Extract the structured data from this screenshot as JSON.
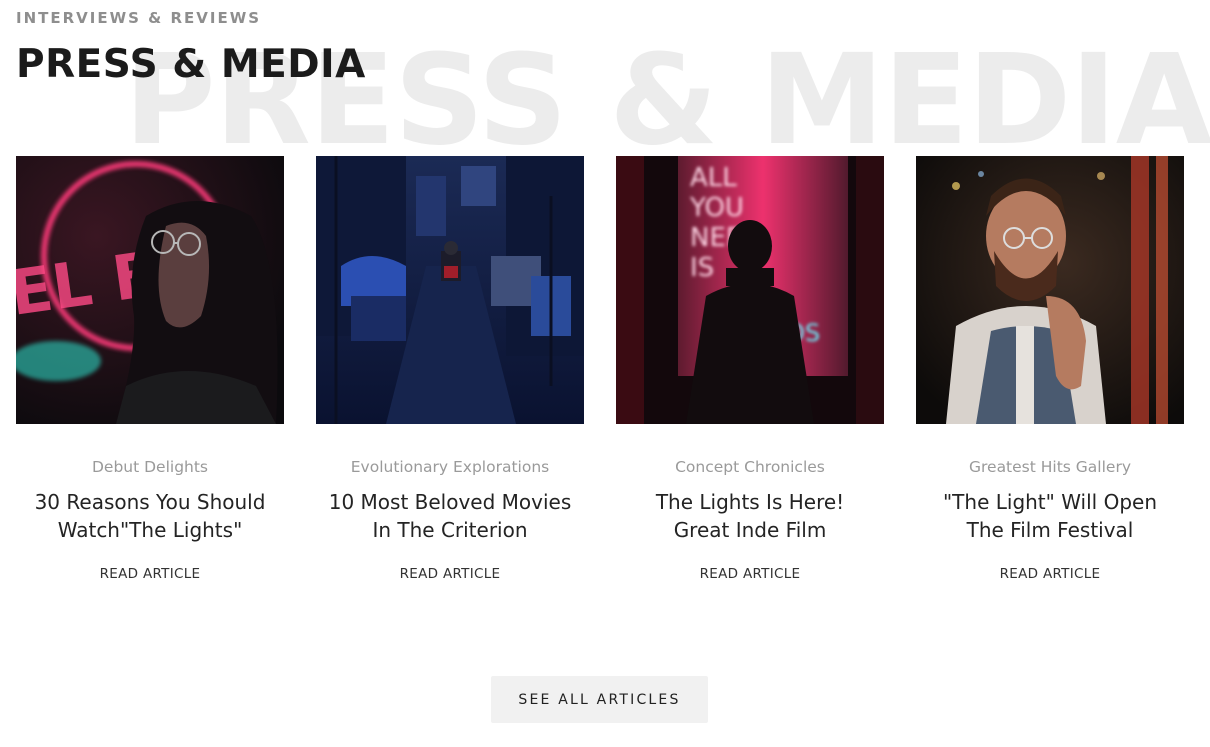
{
  "section": {
    "kicker": "INTERVIEWS & REVIEWS",
    "title": "PRESS & MEDIA",
    "background_title": "PRESS & MEDIA"
  },
  "articles": [
    {
      "category": "Debut Delights",
      "title_line1": "30 Reasons You Should",
      "title_line2": "Watch\"The Lights\"",
      "cta": "READ ARTICLE",
      "image": "woman-with-glasses-neon-sign-photo",
      "neon_sign_text": "EL B"
    },
    {
      "category": "Evolutionary Explorations",
      "title_line1": "10 Most Beloved Movies",
      "title_line2": "In The Criterion",
      "cta": "READ ARTICLE",
      "image": "night-alley-blue-photo"
    },
    {
      "category": "Concept Chronicles",
      "title_line1": "The Lights Is Here!",
      "title_line2": "Great Inde Film",
      "cta": "READ ARTICLE",
      "image": "man-before-neon-sign-photo",
      "neon_sign_text": "ALL YOU NEED IS LOVE"
    },
    {
      "category": "Greatest Hits Gallery",
      "title_line1": "\"The Light\" Will Open",
      "title_line2": "The Film Festival",
      "cta": "READ ARTICLE",
      "image": "bearded-man-glasses-photo"
    }
  ],
  "see_all": "SEE ALL ARTICLES",
  "colors": {
    "kicker": "#8e8e8e",
    "title": "#1b1b1b",
    "background_title": "#ececec",
    "button_bg": "#f1f1f1",
    "neon_pink": "#ff2d6f",
    "neon_cyan": "#2ee6d0"
  }
}
